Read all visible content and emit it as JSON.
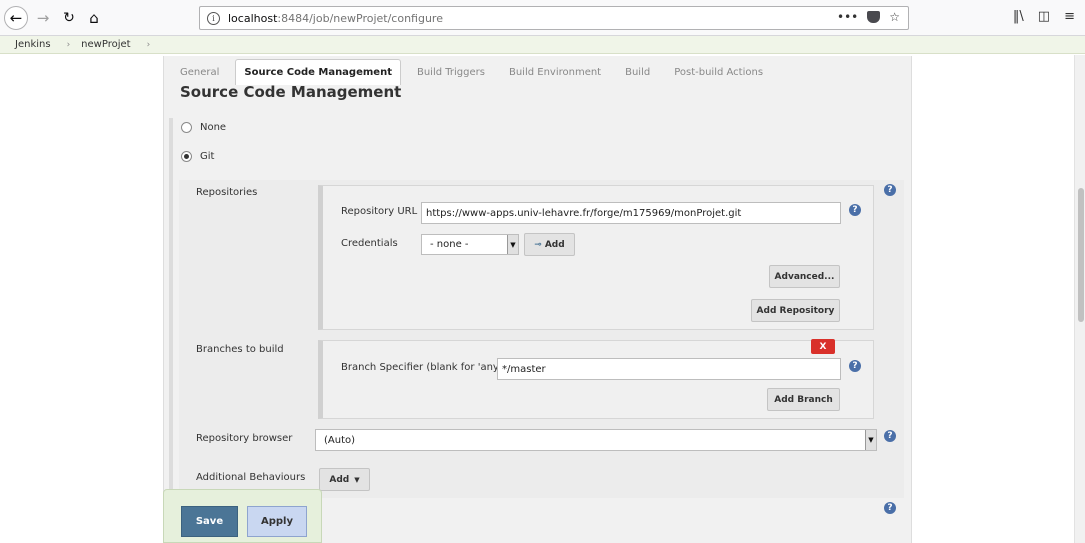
{
  "browser": {
    "url_host": "localhost",
    "url_rest": ":8484/job/newProjet/configure",
    "page_actions": "•••"
  },
  "breadcrumb": [
    "Jenkins",
    "newProjet"
  ],
  "tabs": [
    "General",
    "Source Code Management",
    "Build Triggers",
    "Build Environment",
    "Build",
    "Post-build Actions"
  ],
  "section_title": "Source Code Management",
  "scm_options": {
    "none_label": "None",
    "git_label": "Git"
  },
  "repositories": {
    "label": "Repositories",
    "url_label": "Repository URL",
    "url_value": "https://www-apps.univ-lehavre.fr/forge/m175969/monProjet.git",
    "credentials_label": "Credentials",
    "credentials_value": "- none -",
    "add_label": "Add",
    "advanced_label": "Advanced...",
    "add_repository_label": "Add Repository"
  },
  "branches": {
    "label": "Branches to build",
    "delete_label": "X",
    "specifier_label": "Branch Specifier (blank for 'any')",
    "specifier_value": "*/master",
    "add_branch_label": "Add Branch"
  },
  "repo_browser": {
    "label": "Repository browser",
    "value": "(Auto)"
  },
  "additional_behaviours": {
    "label": "Additional Behaviours",
    "add_label": "Add"
  },
  "footer": {
    "save_label": "Save",
    "apply_label": "Apply"
  }
}
